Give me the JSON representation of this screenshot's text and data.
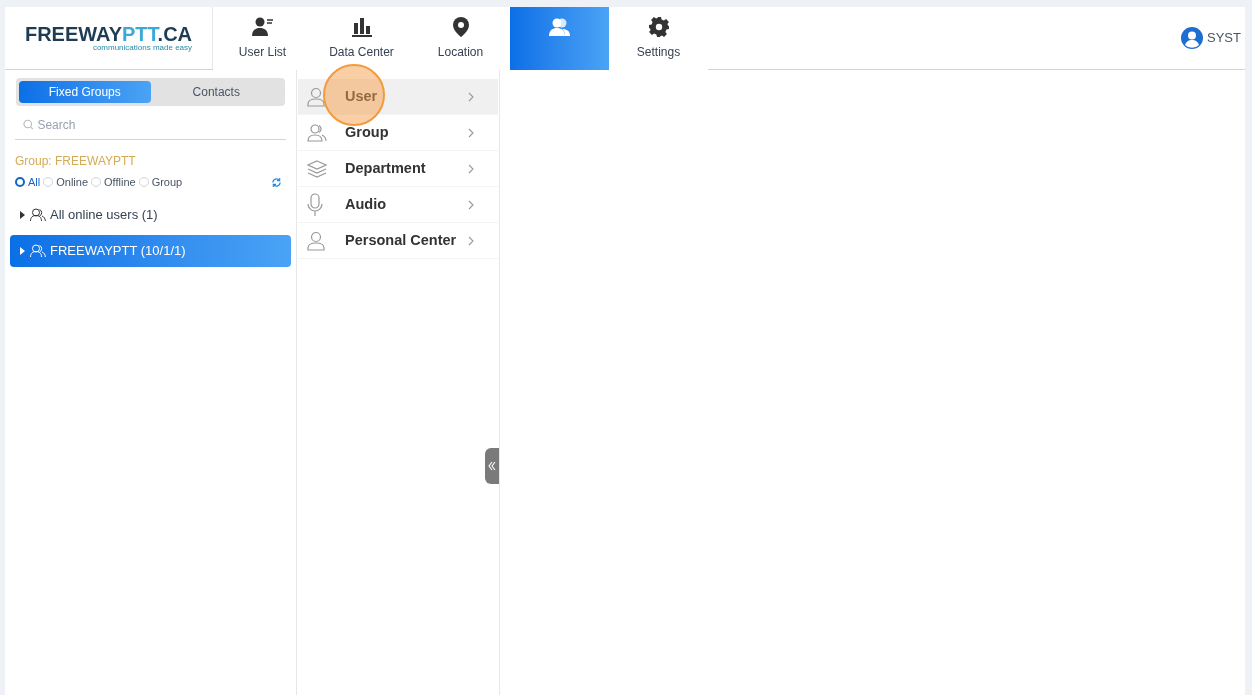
{
  "logo": {
    "brand": "FREEWAY",
    "accent": "PTT",
    "suffix": ".CA",
    "tagline": "communications made easy"
  },
  "nav": [
    {
      "kind": "user-list",
      "label": "User List",
      "selected": false
    },
    {
      "kind": "chart",
      "label": "Data Center",
      "selected": false
    },
    {
      "kind": "pin",
      "label": "Location",
      "selected": false
    },
    {
      "kind": "users",
      "selected": true
    },
    {
      "kind": "gear",
      "label": "Settings",
      "selected": false
    }
  ],
  "account": {
    "name": "SYST"
  },
  "sidebar": {
    "tabs": [
      {
        "label": "Fixed Groups",
        "selected": true
      },
      {
        "label": "Contacts",
        "selected": false
      }
    ],
    "search": {
      "placeholder": "Search"
    },
    "group_label": "Group: FREEWAYPTT",
    "filters": [
      {
        "label": "All",
        "selected": true
      },
      {
        "label": "Online",
        "selected": false
      },
      {
        "label": "Offline",
        "selected": false
      },
      {
        "label": "Group",
        "selected": false
      }
    ],
    "tree": [
      {
        "label": "All online users (1)",
        "selected": false,
        "expanded": false
      },
      {
        "label": "FREEWAYPTT (10/1/1)",
        "selected": true,
        "expanded": false
      }
    ]
  },
  "menu": [
    {
      "kind": "user",
      "label": "User",
      "selected": true,
      "highlighted": true
    },
    {
      "kind": "group",
      "label": "Group",
      "selected": false,
      "highlighted": false
    },
    {
      "kind": "layers",
      "label": "Department",
      "selected": false,
      "highlighted": false
    },
    {
      "kind": "mic",
      "label": "Audio",
      "selected": false,
      "highlighted": false
    },
    {
      "kind": "user",
      "label": "Personal Center",
      "selected": false,
      "highlighted": false
    }
  ]
}
